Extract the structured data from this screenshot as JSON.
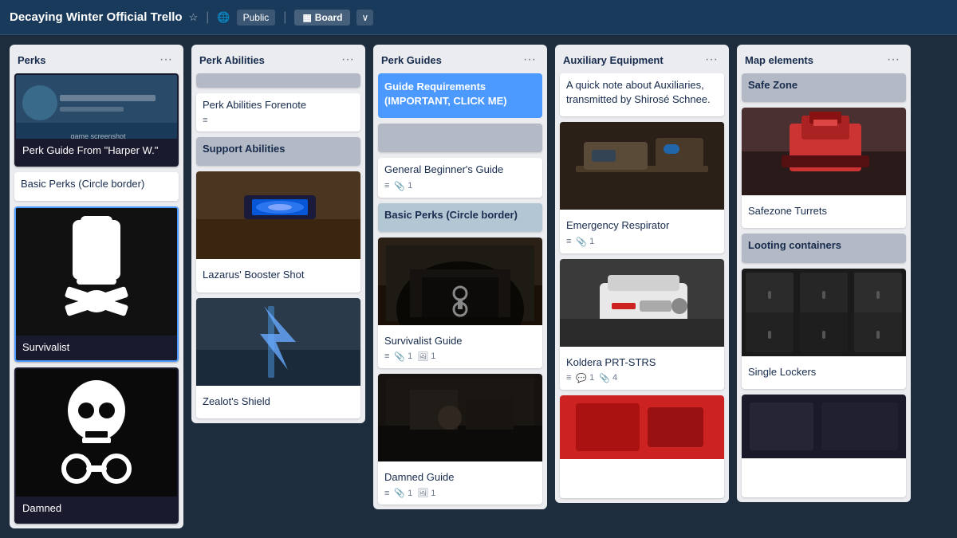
{
  "topbar": {
    "title": "Decaying Winter Official Trello",
    "star_label": "☆",
    "visibility": "Public",
    "globe_icon": "🌐",
    "board_btn": "Board",
    "board_icon": "▦",
    "chevron": "∨"
  },
  "columns": [
    {
      "id": "perks",
      "title": "Perks",
      "cards": [
        {
          "type": "image-dark",
          "title": "Perk Guide From \"Harper W.\"",
          "img_type": "harper",
          "selected": false
        },
        {
          "type": "gray",
          "title": "Basic Perks (Circle border)",
          "selected": true
        },
        {
          "type": "image-dark",
          "title": "Survivalist",
          "img_type": "survivalist",
          "selected": true,
          "badges": []
        },
        {
          "type": "image-dark",
          "title": "Damned",
          "img_type": "damned",
          "selected": false
        }
      ]
    },
    {
      "id": "perk-abilities",
      "title": "Perk Abilities",
      "cards": [
        {
          "type": "gray-label",
          "title": "",
          "is_empty_gray": true
        },
        {
          "type": "plain",
          "title": "Perk Abilities Forenote",
          "badges": [
            {
              "icon": "≡",
              "label": ""
            }
          ]
        },
        {
          "type": "gray-label",
          "title": "Support Abilities"
        },
        {
          "type": "image",
          "title": "Lazarus' Booster Shot",
          "img_type": "lazarus"
        },
        {
          "type": "image",
          "title": "Zealot's Shield",
          "img_type": "zealot"
        }
      ]
    },
    {
      "id": "perk-guides",
      "title": "Perk Guides",
      "cards": [
        {
          "type": "highlight",
          "title": "Guide Requirements (IMPORTANT, CLICK ME)"
        },
        {
          "type": "gray-label-empty",
          "title": ""
        },
        {
          "type": "plain",
          "title": "General Beginner's Guide",
          "badges": [
            {
              "icon": "≡",
              "label": ""
            },
            {
              "icon": "📎",
              "count": "1"
            }
          ]
        },
        {
          "type": "blue-gray",
          "title": "Basic Perks (Circle border)"
        },
        {
          "type": "image",
          "title": "Survivalist Guide",
          "img_type": "survivalist-guide",
          "badges": [
            {
              "icon": "≡",
              "label": ""
            },
            {
              "icon": "📎",
              "count": "1"
            },
            {
              "icon": "🖼",
              "count": "1"
            }
          ]
        },
        {
          "type": "image",
          "title": "Damned Guide",
          "img_type": "damned-guide",
          "badges": [
            {
              "icon": "≡",
              "label": ""
            },
            {
              "icon": "📎",
              "count": "1"
            },
            {
              "icon": "🖼",
              "count": "1"
            }
          ]
        }
      ]
    },
    {
      "id": "auxiliary-equipment",
      "title": "Auxiliary Equipment",
      "cards": [
        {
          "type": "plain-text",
          "title": "A quick note about Auxiliaries, transmitted by Shirosé Schnee."
        },
        {
          "type": "image",
          "title": "Emergency Respirator",
          "img_type": "respirator",
          "badges": [
            {
              "icon": "≡",
              "label": ""
            },
            {
              "icon": "📎",
              "count": "1"
            }
          ]
        },
        {
          "type": "image",
          "title": "Koldera PRT-STRS",
          "img_type": "koldera",
          "badges": [
            {
              "icon": "≡",
              "label": ""
            },
            {
              "icon": "💬",
              "count": "1"
            },
            {
              "icon": "📎",
              "count": "4"
            }
          ]
        },
        {
          "type": "image",
          "title": "",
          "img_type": "aux-partial"
        }
      ]
    },
    {
      "id": "map-elements",
      "title": "Map elements",
      "cards": [
        {
          "type": "gray-label",
          "title": "Safe Zone"
        },
        {
          "type": "image",
          "title": "Safezone Turrets",
          "img_type": "turrets"
        },
        {
          "type": "gray-label",
          "title": "Looting containers"
        },
        {
          "type": "image",
          "title": "Single Lockers",
          "img_type": "lockers"
        },
        {
          "type": "image",
          "title": "",
          "img_type": "map-partial"
        }
      ]
    }
  ]
}
